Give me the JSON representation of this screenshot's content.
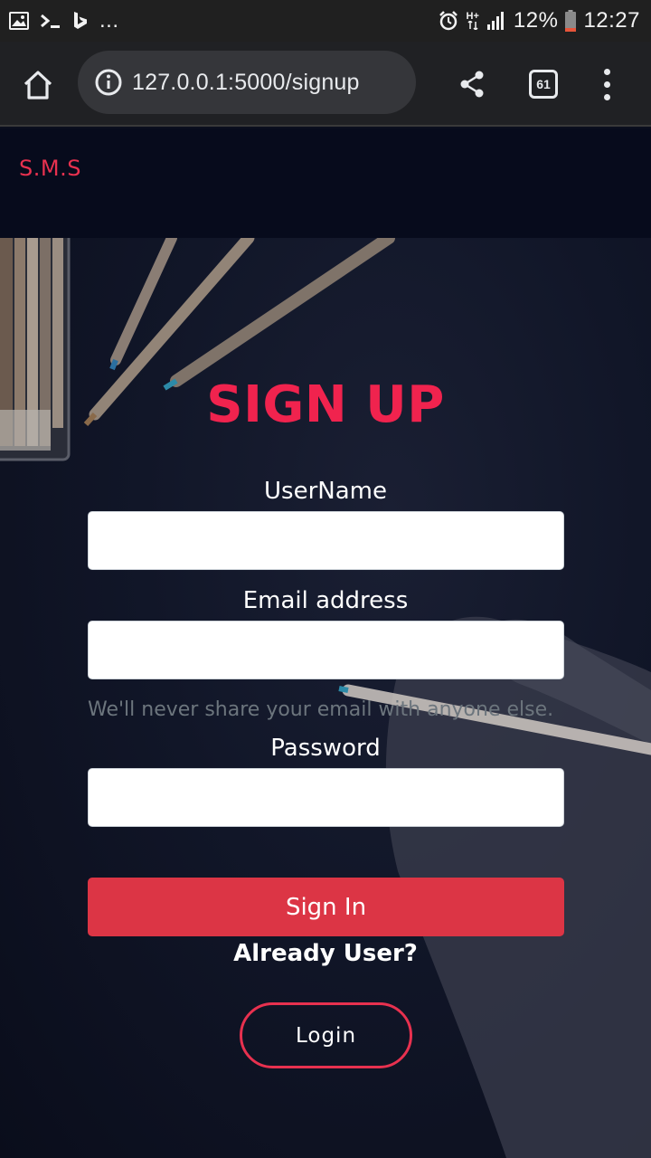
{
  "status_bar": {
    "battery": "12%",
    "time": "12:27",
    "network": "H+",
    "left_icons": [
      "image-icon",
      "terminal-icon",
      "bing-icon",
      "more-notifications-icon"
    ],
    "right_icons": [
      "alarm-icon",
      "network-type-icon",
      "signal-icon",
      "battery-icon"
    ],
    "overflow": "..."
  },
  "browser": {
    "url": "127.0.0.1:5000/signup",
    "tab_count": "61"
  },
  "site": {
    "brand": "S.M.S"
  },
  "form": {
    "title": "SIGN UP",
    "username_label": "UserName",
    "username_value": "",
    "email_label": "Email address",
    "email_value": "",
    "email_help": "We'll never share your email with anyone else.",
    "password_label": "Password",
    "password_value": "",
    "submit_label": "Sign In",
    "already_user": "Already User?",
    "login_label": "Login"
  },
  "colors": {
    "brand": "#e8314f",
    "title": "#f0234e",
    "submit_bg": "#dc3545",
    "page_bg": "#0b0f1e"
  }
}
